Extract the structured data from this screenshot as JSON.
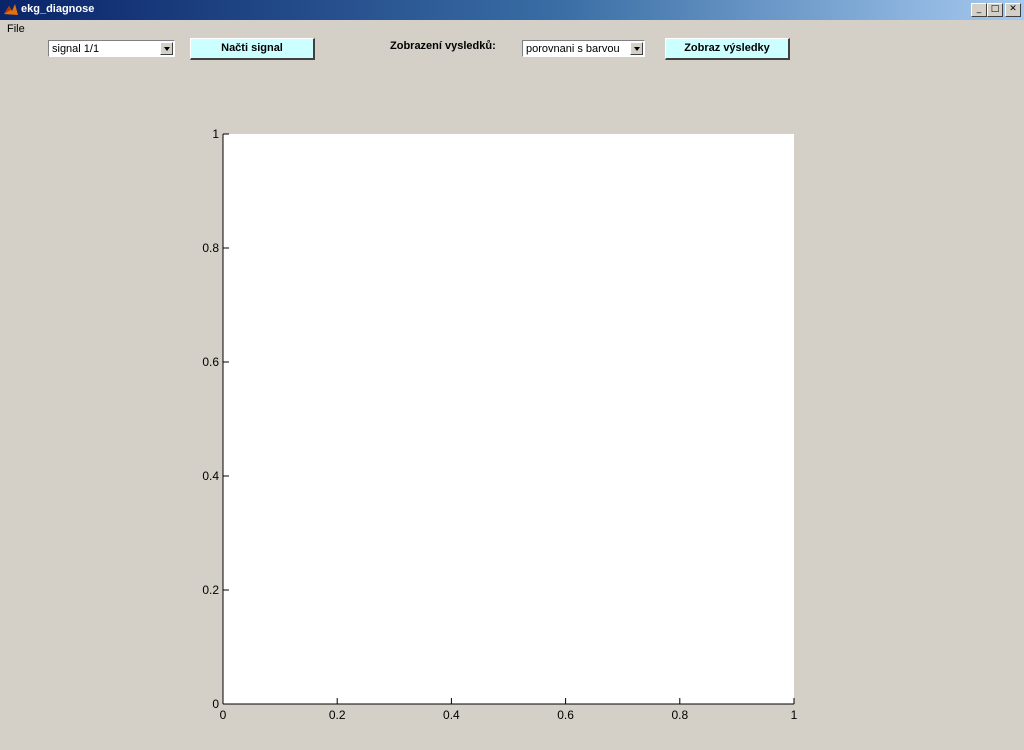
{
  "window": {
    "title": "ekg_diagnose",
    "controls": [
      "_",
      "□",
      "✕"
    ]
  },
  "menu": {
    "items": [
      "File"
    ]
  },
  "controls": {
    "signal_select": {
      "value": "signal 1/1"
    },
    "load_button": {
      "label": "Načti signal"
    },
    "results_label": "Zobrazení vysledků:",
    "results_select": {
      "value": "porovnani s barvou"
    },
    "show_button": {
      "label": "Zobraz výsledky"
    }
  },
  "colors": {
    "face": "#d4d0c8",
    "button_face": "#ccffff",
    "title_start": "#0a246a",
    "title_end": "#a6caf0"
  },
  "chart_data": {
    "type": "line",
    "series": [],
    "xlim": [
      0,
      1
    ],
    "ylim": [
      0,
      1
    ],
    "xticks": [
      "0",
      "0.2",
      "0.4",
      "0.6",
      "0.8",
      "1"
    ],
    "yticks": [
      "0",
      "0.2",
      "0.4",
      "0.6",
      "0.8",
      "1"
    ],
    "grid": false
  }
}
